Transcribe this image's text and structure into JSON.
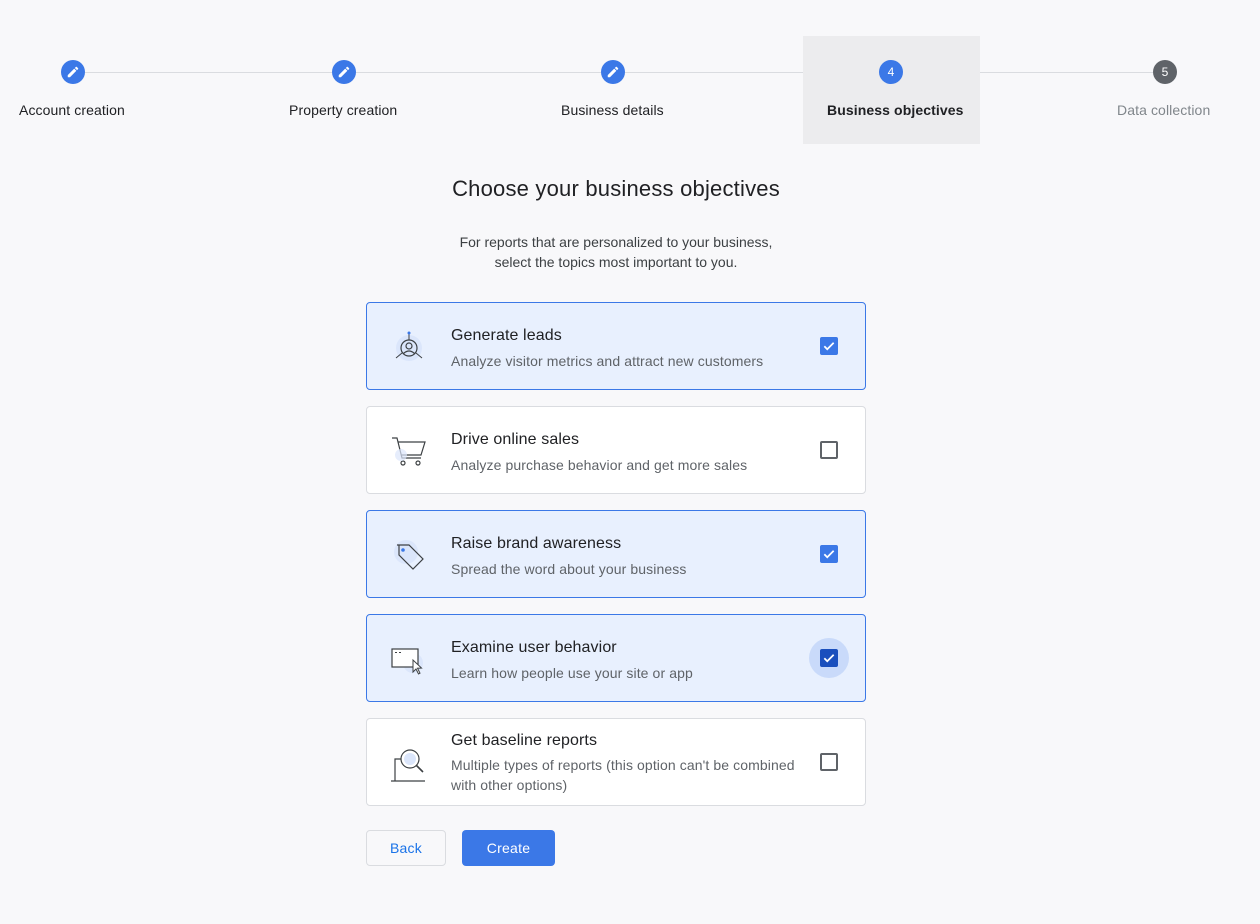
{
  "stepper": {
    "steps": [
      {
        "label": "Account creation",
        "state": "done",
        "icon": "pencil-icon",
        "number": ""
      },
      {
        "label": "Property creation",
        "state": "done",
        "icon": "pencil-icon",
        "number": ""
      },
      {
        "label": "Business details",
        "state": "done",
        "icon": "pencil-icon",
        "number": ""
      },
      {
        "label": "Business objectives",
        "state": "current",
        "icon": "",
        "number": "4"
      },
      {
        "label": "Data collection",
        "state": "todo",
        "icon": "",
        "number": "5"
      }
    ]
  },
  "page": {
    "title": "Choose your business objectives",
    "subtitle_line1": "For reports that are personalized to your business,",
    "subtitle_line2": "select the topics most important to you."
  },
  "options": [
    {
      "title": "Generate leads",
      "description": "Analyze visitor metrics and attract new customers",
      "checked": true,
      "icon": "leads-icon"
    },
    {
      "title": "Drive online sales",
      "description": "Analyze purchase behavior and get more sales",
      "checked": false,
      "icon": "shopping-cart-icon"
    },
    {
      "title": "Raise brand awareness",
      "description": "Spread the word about your business",
      "checked": true,
      "icon": "price-tag-icon"
    },
    {
      "title": "Examine user behavior",
      "description": "Learn how people use your site or app",
      "checked": true,
      "icon": "browser-cursor-icon"
    },
    {
      "title": "Get baseline reports",
      "description": "Multiple types of reports (this option can't be combined with other options)",
      "checked": false,
      "icon": "magnifier-report-icon"
    }
  ],
  "buttons": {
    "back_label": "Back",
    "create_label": "Create"
  },
  "colors": {
    "accent": "#3b78e7",
    "selected_bg": "#e8f0fe",
    "page_bg": "#f8f8fa"
  }
}
